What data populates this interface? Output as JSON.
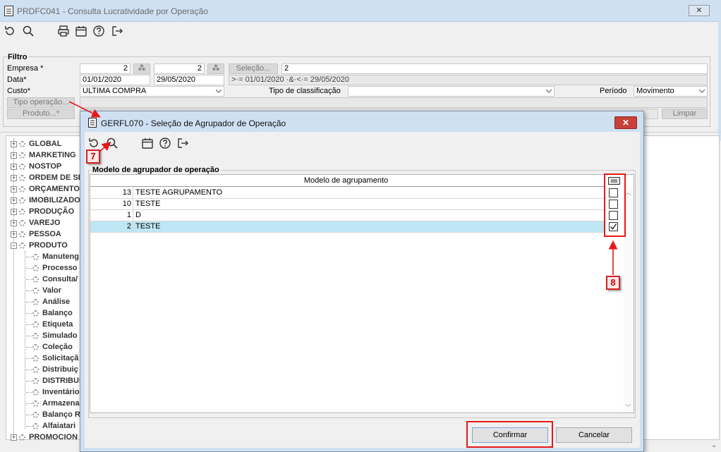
{
  "main_window": {
    "title": "PRDFC041 - Consulta Lucratividade por Operação",
    "close_label": "✕"
  },
  "filter": {
    "group_title": "Filtro",
    "empresa_label": "Empresa *",
    "empresa_value_1": "2",
    "empresa_value_2": "2",
    "selecao_button": "Seleção...",
    "selecao_value": "2",
    "data_label": "Data*",
    "data_start": "01/01/2020",
    "data_end": "29/05/2020",
    "data_summary": ">·= 01/01/2020 ·&·<·= 29/05/2020",
    "custo_label": "Custo*",
    "custo_value": "ULTIMA COMPRA",
    "tipo_classificacao_label": "Tipo de classificação",
    "tipo_classificacao_value": "",
    "periodo_label": "Período",
    "periodo_value": "Movimento",
    "tipo_operacao_button": "Tipo operação...",
    "produto_button": "Produto...*",
    "limpar_button": "Limpar"
  },
  "tree": {
    "items": [
      {
        "label": "GLOBAL"
      },
      {
        "label": "MARKETING"
      },
      {
        "label": "NOSTOP"
      },
      {
        "label": "ORDEM DE SE"
      },
      {
        "label": "ORÇAMENTO"
      },
      {
        "label": "IMOBILIZADO"
      },
      {
        "label": "PRODUÇÃO"
      },
      {
        "label": "VAREJO"
      },
      {
        "label": "PESSOA"
      },
      {
        "label": "PRODUTO"
      }
    ],
    "children": [
      {
        "label": "Manuteng"
      },
      {
        "label": "Processo"
      },
      {
        "label": "Consulta/"
      },
      {
        "label": "Valor"
      },
      {
        "label": "Análise"
      },
      {
        "label": "Balanço"
      },
      {
        "label": "Etiqueta"
      },
      {
        "label": "Simulado"
      },
      {
        "label": "Coleção"
      },
      {
        "label": "Solicitaçã"
      },
      {
        "label": "Distribuiç"
      },
      {
        "label": "DISTRIBUI"
      },
      {
        "label": "Inventário"
      },
      {
        "label": "Armazena"
      },
      {
        "label": "Balanço R"
      },
      {
        "label": "Alfaiatari"
      }
    ],
    "last": {
      "label": "PROMOCION"
    }
  },
  "dialog": {
    "title": "GERFL070 - Seleção de Agrupador de Operação",
    "group_title": "Modelo de agrupador de operação",
    "column_header": "Modelo de agrupamento",
    "rows": [
      {
        "code": "13",
        "name": "TESTE AGRUPAMENTO",
        "checked": false
      },
      {
        "code": "10",
        "name": "TESTE",
        "checked": false
      },
      {
        "code": "1",
        "name": "D",
        "checked": false
      },
      {
        "code": "2",
        "name": "TESTE",
        "checked": true
      }
    ],
    "confirm_button": "Confirmar",
    "cancel_button": "Cancelar"
  },
  "annotations": {
    "badge_7": "7",
    "badge_8": "8"
  },
  "colors": {
    "title_bar": "#cfe0f3",
    "dialog_title_bar": "#cfe0f3",
    "selected_row": "#bfe6f5",
    "callout_red": "#e81818",
    "close_red": "#c7403a"
  }
}
